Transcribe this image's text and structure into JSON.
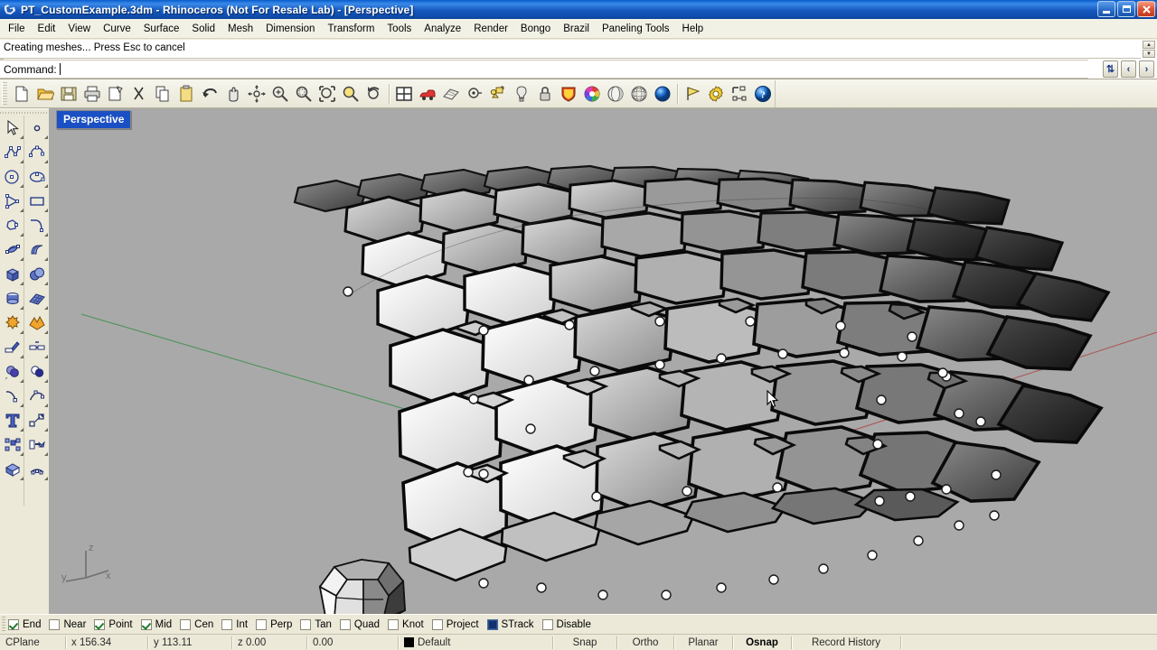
{
  "window": {
    "title": "PT_CustomExample.3dm - Rhinoceros (Not For Resale Lab) - [Perspective]",
    "app_icon": "rhino-logo-icon",
    "minimize_label": "Minimize",
    "maximize_label": "Restore",
    "close_label": "Close"
  },
  "menubar": {
    "items": [
      {
        "label": "File"
      },
      {
        "label": "Edit"
      },
      {
        "label": "View"
      },
      {
        "label": "Curve"
      },
      {
        "label": "Surface"
      },
      {
        "label": "Solid"
      },
      {
        "label": "Mesh"
      },
      {
        "label": "Dimension"
      },
      {
        "label": "Transform"
      },
      {
        "label": "Tools"
      },
      {
        "label": "Analyze"
      },
      {
        "label": "Render"
      },
      {
        "label": "Bongo"
      },
      {
        "label": "Brazil"
      },
      {
        "label": "Paneling Tools"
      },
      {
        "label": "Help"
      }
    ]
  },
  "command_area": {
    "history": "Creating meshes... Press Esc to cancel",
    "prompt_label": "Command:",
    "prompt_value": "",
    "scroll_up_label": "▲",
    "scroll_down_label": "▼",
    "nav_updown_label": "⇅",
    "nav_prev_label": "‹",
    "nav_next_label": "›"
  },
  "toolbar": {
    "items": [
      {
        "name": "new-file-icon",
        "title": "New"
      },
      {
        "name": "open-file-icon",
        "title": "Open"
      },
      {
        "name": "save-file-icon",
        "title": "Save"
      },
      {
        "name": "print-icon",
        "title": "Print"
      },
      {
        "name": "cut-page-icon",
        "title": "Cut"
      },
      {
        "name": "scissors-icon",
        "title": "Cut"
      },
      {
        "name": "copy-icon",
        "title": "Copy"
      },
      {
        "name": "paste-icon",
        "title": "Paste"
      },
      {
        "name": "undo-icon",
        "title": "Undo"
      },
      {
        "name": "pan-hand-icon",
        "title": "Pan"
      },
      {
        "name": "rotate-view-icon",
        "title": "Rotate View"
      },
      {
        "name": "zoom-in-icon",
        "title": "Zoom In"
      },
      {
        "name": "zoom-window-icon",
        "title": "Zoom Window"
      },
      {
        "name": "zoom-extents-icon",
        "title": "Zoom Extents"
      },
      {
        "name": "zoom-selected-icon",
        "title": "Zoom Selected"
      },
      {
        "name": "zoom-previous-icon",
        "title": "Zoom Previous"
      },
      {
        "name": "four-view-icon",
        "title": "4 Viewports"
      },
      {
        "name": "car-render-icon",
        "title": "Render"
      },
      {
        "name": "plan-view-icon",
        "title": "Plan View"
      },
      {
        "name": "point-object-icon",
        "title": "Point"
      },
      {
        "name": "group-objects-icon",
        "title": "Group"
      },
      {
        "name": "light-bulb-icon",
        "title": "Lights"
      },
      {
        "name": "lock-icon",
        "title": "Lock"
      },
      {
        "name": "shield-icon",
        "title": "Layers"
      },
      {
        "name": "color-wheel-icon",
        "title": "Color"
      },
      {
        "name": "shaded-sphere-icon",
        "title": "Shaded"
      },
      {
        "name": "wireframe-sphere-icon",
        "title": "Wireframe"
      },
      {
        "name": "render-sphere-icon",
        "title": "Rendered"
      },
      {
        "name": "flag-icon",
        "title": "Flag"
      },
      {
        "name": "gear-icon",
        "title": "Options"
      },
      {
        "name": "dimension-icon",
        "title": "Dimension"
      },
      {
        "name": "help-icon",
        "title": "Help"
      }
    ]
  },
  "sidebar": {
    "rows": [
      {
        "left": "select-arrow-icon",
        "right": "point-object-icon"
      },
      {
        "left": "polyline-icon",
        "right": "control-curve-icon"
      },
      {
        "left": "circle-icon",
        "right": "ellipse-icon"
      },
      {
        "left": "triangle-curve-icon",
        "right": "rectangle-icon"
      },
      {
        "left": "polygon-icon",
        "right": "arc-curve-icon"
      },
      {
        "left": "surface-patch-icon",
        "right": "surface-sweep-icon"
      },
      {
        "left": "box-solid-icon",
        "right": "sphere-solid-icon"
      },
      {
        "left": "cylinder-solid-icon",
        "right": "mesh-plane-icon"
      },
      {
        "left": "explode-icon",
        "right": "boolean-split-icon"
      },
      {
        "left": "trim-icon",
        "right": "join-icon"
      },
      {
        "left": "fillet-icon",
        "right": "offset-icon"
      },
      {
        "left": "boolean-union-icon",
        "right": "boolean-difference-icon"
      },
      {
        "left": "curve-point-icon",
        "right": "curve-edit-icon"
      },
      {
        "left": "text-tool-icon",
        "right": "scale-icon"
      },
      {
        "left": "array-icon",
        "right": "extrude-icon"
      },
      {
        "left": "cap-solid-icon",
        "right": "unroll-surface-icon"
      }
    ]
  },
  "viewport": {
    "label": "Perspective",
    "background_color": "#a9a9a9",
    "axis_gizmo": {
      "x_label": "x",
      "y_label": "y",
      "z_label": "z"
    },
    "x_axis_color": "#b04a4a",
    "y_axis_color": "#3e8f4a",
    "cursor": "arrow-cursor",
    "model_name": "paneled-hexagonal-surface",
    "reference_object": "paneled-dome-thumbnail"
  },
  "osnap": {
    "items": [
      {
        "label": "End",
        "state": "checked"
      },
      {
        "label": "Near",
        "state": "unchecked"
      },
      {
        "label": "Point",
        "state": "checked"
      },
      {
        "label": "Mid",
        "state": "checked"
      },
      {
        "label": "Cen",
        "state": "unchecked"
      },
      {
        "label": "Int",
        "state": "unchecked"
      },
      {
        "label": "Perp",
        "state": "unchecked"
      },
      {
        "label": "Tan",
        "state": "unchecked"
      },
      {
        "label": "Quad",
        "state": "unchecked"
      },
      {
        "label": "Knot",
        "state": "unchecked"
      },
      {
        "label": "Project",
        "state": "unchecked"
      },
      {
        "label": "STrack",
        "state": "filled"
      },
      {
        "label": "Disable",
        "state": "unchecked"
      }
    ]
  },
  "statusbar": {
    "cplane_label": "CPlane",
    "x_value": "x 156.34",
    "y_value": "y 113.11",
    "z_value": "z 0.00",
    "extra_value": "0.00",
    "layer_name": "Default",
    "layer_color": "#000000",
    "toggles": [
      {
        "label": "Snap",
        "active": false
      },
      {
        "label": "Ortho",
        "active": false
      },
      {
        "label": "Planar",
        "active": false
      },
      {
        "label": "Osnap",
        "active": true
      },
      {
        "label": "Record History",
        "active": false
      }
    ]
  }
}
